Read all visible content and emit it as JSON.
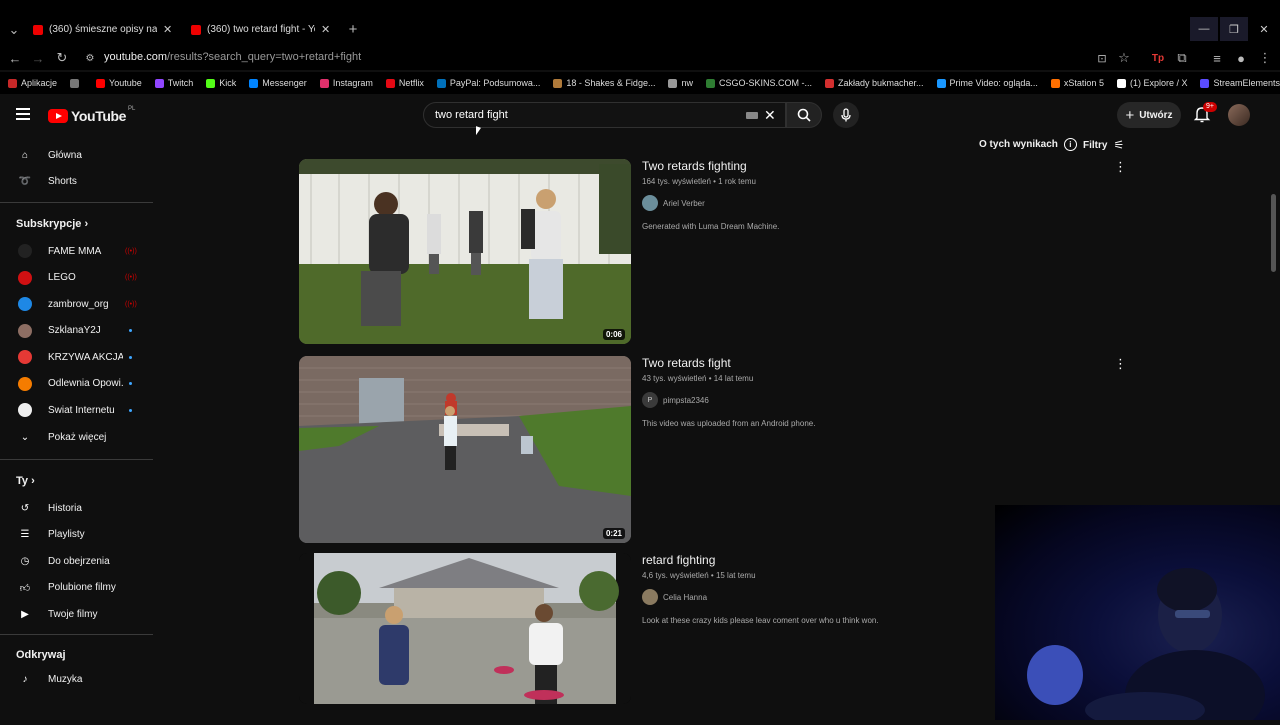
{
  "browser": {
    "tabs": [
      {
        "label": "(360) śmieszne opisy na tinder..."
      },
      {
        "label": "(360) two retard fight - YouTube"
      }
    ],
    "new_tab": "+",
    "url_host": "youtube.com",
    "url_rest": "/results?search_query=two+retard+fight",
    "bookmarks": [
      {
        "label": "Aplikacje",
        "color": "#c62828"
      },
      {
        "label": "",
        "color": "#777777"
      },
      {
        "label": "Youtube",
        "color": "#ff0000"
      },
      {
        "label": "Twitch",
        "color": "#9146ff"
      },
      {
        "label": "Kick",
        "color": "#53fc18"
      },
      {
        "label": "Messenger",
        "color": "#0084ff"
      },
      {
        "label": "Instagram",
        "color": "#e1306c"
      },
      {
        "label": "Netflix",
        "color": "#e50914"
      },
      {
        "label": "PayPal: Podsumowa...",
        "color": "#0070ba"
      },
      {
        "label": "18 - Shakes & Fidge...",
        "color": "#b07a3a"
      },
      {
        "label": "nw",
        "color": "#999999"
      },
      {
        "label": "CSGO-SKINS.COM -...",
        "color": "#2e7d32"
      },
      {
        "label": "Zakłady bukmacher...",
        "color": "#d32f2f"
      },
      {
        "label": "Prime Video: ogląda...",
        "color": "#1a98ff"
      },
      {
        "label": "xStation 5",
        "color": "#ff6f00"
      },
      {
        "label": "(1) Explore / X",
        "color": "#ffffff"
      },
      {
        "label": "StreamElements - M...",
        "color": "#5b4cff"
      }
    ]
  },
  "youtube": {
    "logo_text": "YouTube",
    "region": "PL",
    "search_query": "two retard fight",
    "create_label": "Utwórz",
    "notif_badge": "9+",
    "about_results": "O tych wynikach",
    "filters": "Filtry"
  },
  "sidebar": {
    "main": [
      {
        "label": "Główna",
        "icon": "home-icon"
      },
      {
        "label": "Shorts",
        "icon": "shorts-icon"
      }
    ],
    "subs_header": "Subskrypcje",
    "subs": [
      {
        "label": "FAME MMA",
        "status": "live",
        "color": "#222222"
      },
      {
        "label": "LEGO",
        "status": "live",
        "color": "#d01012"
      },
      {
        "label": "zambrow_org",
        "status": "live",
        "color": "#1e88e5"
      },
      {
        "label": "SzklanaY2J",
        "status": "new",
        "color": "#8d6e63"
      },
      {
        "label": "KRZYWA AKCJA",
        "status": "new",
        "color": "#e53935"
      },
      {
        "label": "Odlewnia Opowi...",
        "status": "new",
        "color": "#f57c00"
      },
      {
        "label": "Świat Internetu",
        "status": "new",
        "color": "#eeeeee"
      }
    ],
    "show_more": "Pokaż więcej",
    "you_header": "Ty",
    "you": [
      {
        "label": "Historia",
        "icon": "history-icon"
      },
      {
        "label": "Playlisty",
        "icon": "playlists-icon"
      },
      {
        "label": "Do obejrzenia",
        "icon": "watch-later-icon"
      },
      {
        "label": "Polubione filmy",
        "icon": "like-icon"
      },
      {
        "label": "Twoje filmy",
        "icon": "your-videos-icon"
      }
    ],
    "explore_header": "Odkrywaj",
    "explore": [
      {
        "label": "Muzyka",
        "icon": "music-icon"
      }
    ]
  },
  "results": [
    {
      "title": "Two retards fighting",
      "meta": "164 tys. wyświetleń • 1 rok temu",
      "channel": "Ariel Verber",
      "channel_initial": "",
      "channel_color": "#6b8e9b",
      "description": "Generated with Luma Dream Machine.",
      "duration": "0:06"
    },
    {
      "title": "Two retards fight",
      "meta": "43 tys. wyświetleń • 14 lat temu",
      "channel": "pimpsta2346",
      "channel_initial": "P",
      "channel_color": "#3a3a3a",
      "description": "This video was uploaded from an Android phone.",
      "duration": "0:21"
    },
    {
      "title": "retard fighting",
      "meta": "4,6 tys. wyświetleń • 15 lat temu",
      "channel": "Celia Hanna",
      "channel_initial": "",
      "channel_color": "#8a7a60",
      "description": "Look at these crazy kids please leav coment over who u think won.",
      "duration": ""
    }
  ]
}
